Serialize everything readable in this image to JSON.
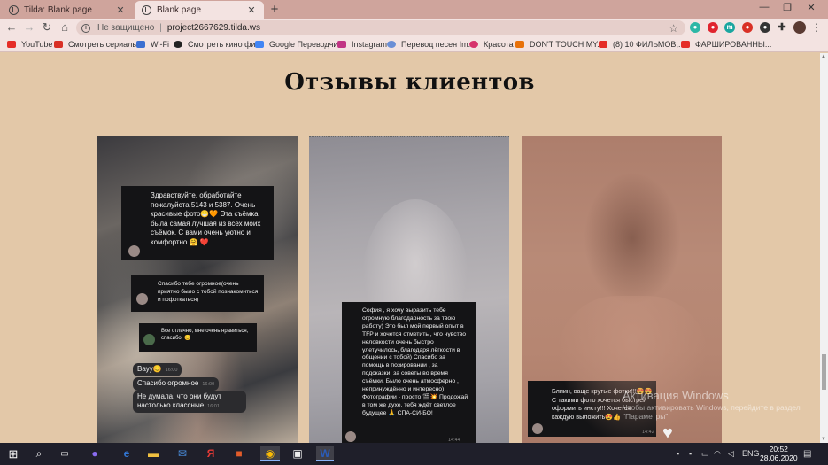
{
  "browser": {
    "tabs": [
      {
        "title": "Tilda: Blank page",
        "active": false
      },
      {
        "title": "Blank page",
        "active": true
      }
    ],
    "omnibox": {
      "status": "Не защищено",
      "url": "project2667629.tilda.ws"
    },
    "bookmarks": [
      {
        "label": "YouTube",
        "color": "#e52d27"
      },
      {
        "label": "Смотреть сериалы...",
        "color": "#d93025"
      },
      {
        "label": "Wi-Fi",
        "color": "#3b6fd1"
      },
      {
        "label": "Смотреть кино фи...",
        "color": "#222222"
      },
      {
        "label": "Google Переводчик",
        "color": "#4285f4"
      },
      {
        "label": "Instagram",
        "color": "#c13584"
      },
      {
        "label": "Перевод песен Im...",
        "color": "#6b8fd6"
      },
      {
        "label": "Красота",
        "color": "#d6336c"
      },
      {
        "label": "DON'T TOUCH MY...",
        "color": "#e8710a"
      },
      {
        "label": "(8) 10 ФИЛЬМОВ,...",
        "color": "#e52d27"
      },
      {
        "label": "ФАРШИРОВАННЫ...",
        "color": "#e52d27"
      }
    ]
  },
  "page": {
    "title": "Отзывы клиентов",
    "review1": {
      "main": "Здравствуйте, обработайте пожалуйста 5143 и 5387. Очень красивые фото😁🧡 Эта съёмка была самая лучшая из всех моих съёмок. С вами очень уютно и комфортно 🤗 ❤️",
      "thanks": "Спасибо тебе огромное(очень приятно было с тобой познакомиться и пофоткаться)",
      "likes": "Все отлично, мне очень нравиться, спасибо! 😊",
      "b1": "Вауу😊",
      "b1_time": "16:00",
      "b2": "Спасибо огромное",
      "b2_time": "16:00",
      "b3": "Не думала, что они будут настолько классные",
      "b3_time": "16:01"
    },
    "review2": {
      "text": "София , я хочу выразить тебе огромную благодарность за твою работу) Это был мой первый опыт в TFP и хочется отметить , что чувство неловкости очень быстро улетучилось, благодаря лёгкости в общении с тобой) Спасибо за помощь в позировании , за подсказки, за советы во время съёмки. Было очень атмосферно , непринуждённо и интересно) Фотографии - просто 🎬💥 Продожай в том же духе, тебя ждёт светлое будущее 🙏 СПА-СИ-БО!",
      "time": "14:44"
    },
    "review3": {
      "text": "Блиин, ваще крутые фотки!!!😍😍 С такими фото хочется быстрей оформить инсту!!! Хочется каждую выложить😍👍",
      "time": "14:42"
    },
    "watermark": {
      "title": "Активация Windows",
      "subtitle": "Чтобы активировать Windows, перейдите в раздел \"Параметры\"."
    }
  },
  "taskbar": {
    "lang": "ENG",
    "time": "20:52",
    "date": "28.06.2020"
  }
}
